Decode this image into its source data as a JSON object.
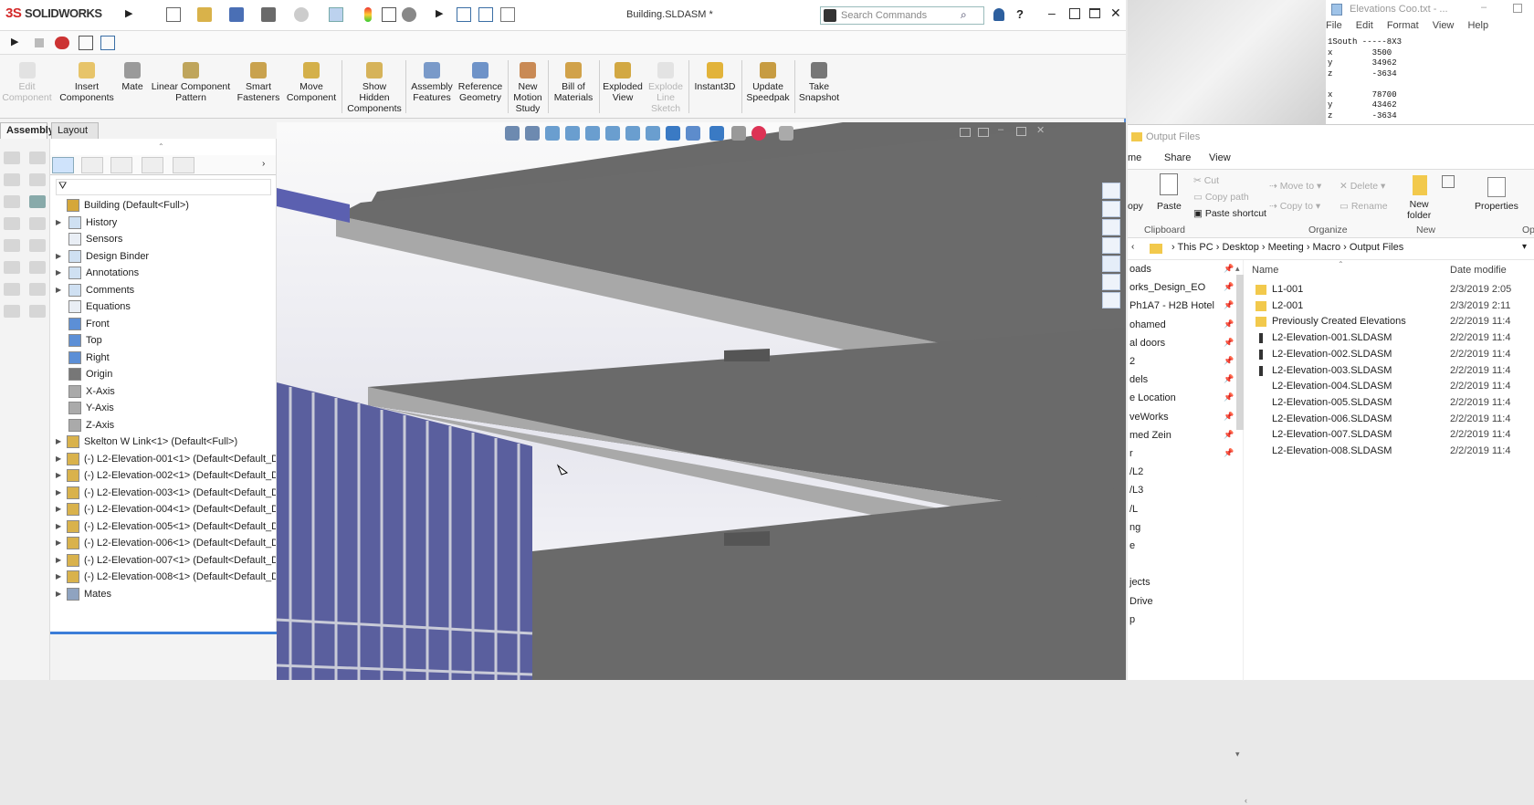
{
  "solidworks": {
    "logo_ds": "3S",
    "logo_text": "SOLIDWORKS",
    "document_title": "Building.SLDASM *",
    "search_placeholder": "Search Commands",
    "commands": [
      {
        "label": "Edit\nComponent",
        "disabled": true
      },
      {
        "label": "Insert\nComponents"
      },
      {
        "label": "Mate"
      },
      {
        "label": "Linear Component\nPattern"
      },
      {
        "label": "Smart\nFasteners"
      },
      {
        "label": "Move\nComponent"
      },
      {
        "label": "Show\nHidden\nComponents"
      },
      {
        "label": "Assembly\nFeatures"
      },
      {
        "label": "Reference\nGeometry"
      },
      {
        "label": "New\nMotion\nStudy"
      },
      {
        "label": "Bill of\nMaterials"
      },
      {
        "label": "Exploded\nView"
      },
      {
        "label": "Explode\nLine\nSketch",
        "disabled": true
      },
      {
        "label": "Instant3D"
      },
      {
        "label": "Update\nSpeedpak"
      },
      {
        "label": "Take\nSnapshot"
      }
    ],
    "tabs": [
      "Assembly",
      "Layout"
    ],
    "tree": [
      {
        "label": "Building  (Default<Full>)",
        "icon": "assembly-icon",
        "level": 0
      },
      {
        "label": "History",
        "icon": "folder-icon",
        "level": 1,
        "arrow": true
      },
      {
        "label": "Sensors",
        "icon": "sensor-icon",
        "level": 1
      },
      {
        "label": "Design Binder",
        "icon": "folder-icon",
        "level": 1,
        "arrow": true
      },
      {
        "label": "Annotations",
        "icon": "annotation-icon",
        "level": 1,
        "arrow": true
      },
      {
        "label": "Comments",
        "icon": "folder-icon",
        "level": 1,
        "arrow": true
      },
      {
        "label": "Equations",
        "icon": "equation-icon",
        "level": 1
      },
      {
        "label": "Front",
        "icon": "plane-icon",
        "level": 1
      },
      {
        "label": "Top",
        "icon": "plane-icon",
        "level": 1
      },
      {
        "label": "Right",
        "icon": "plane-icon",
        "level": 1
      },
      {
        "label": "Origin",
        "icon": "origin-icon",
        "level": 1
      },
      {
        "label": "X-Axis",
        "icon": "axis-icon",
        "level": 1
      },
      {
        "label": "Y-Axis",
        "icon": "axis-icon",
        "level": 1
      },
      {
        "label": "Z-Axis",
        "icon": "axis-icon",
        "level": 1
      },
      {
        "label": "Skelton W Link<1> (Default<Full>)",
        "icon": "part-icon",
        "level": 0,
        "arrow": true
      },
      {
        "label": "(-) L2-Elevation-001<1> (Default<Default_D",
        "icon": "part-icon",
        "level": 0,
        "arrow": true
      },
      {
        "label": "(-) L2-Elevation-002<1> (Default<Default_D",
        "icon": "part-icon",
        "level": 0,
        "arrow": true
      },
      {
        "label": "(-) L2-Elevation-003<1> (Default<Default_D",
        "icon": "part-icon",
        "level": 0,
        "arrow": true
      },
      {
        "label": "(-) L2-Elevation-004<1> (Default<Default_D",
        "icon": "part-icon",
        "level": 0,
        "arrow": true
      },
      {
        "label": "(-) L2-Elevation-005<1> (Default<Default_D",
        "icon": "part-icon",
        "level": 0,
        "arrow": true
      },
      {
        "label": "(-) L2-Elevation-006<1> (Default<Default_D",
        "icon": "part-icon",
        "level": 0,
        "arrow": true
      },
      {
        "label": "(-) L2-Elevation-007<1> (Default<Default_D",
        "icon": "part-icon",
        "level": 0,
        "arrow": true
      },
      {
        "label": "(-) L2-Elevation-008<1> (Default<Default_D",
        "icon": "part-icon",
        "level": 0,
        "arrow": true
      },
      {
        "label": "Mates",
        "icon": "mates-icon",
        "level": 0,
        "arrow": true
      }
    ]
  },
  "notepad": {
    "title": "Elevations Coo.txt - ...",
    "menu": [
      "File",
      "Edit",
      "Format",
      "View",
      "Help"
    ],
    "text": "1South -----8X3\nx        3500\ny        34962\nz        -3634\n\nx        78700\ny        43462\nz        -3634"
  },
  "explorer": {
    "title": "Output Files",
    "ribbon_tabs": [
      "me",
      "Share",
      "View"
    ],
    "ribbon": {
      "copy": "opy",
      "paste": "Paste",
      "cut": "Cut",
      "copy_path": "Copy path",
      "paste_shortcut": "Paste shortcut",
      "move_to": "Move to",
      "copy_to": "Copy to",
      "delete": "Delete",
      "rename": "Rename",
      "new_folder": "New\nfolder",
      "properties": "Properties",
      "open_partial": "Op",
      "group_clipboard": "Clipboard",
      "group_organize": "Organize",
      "group_new": "New"
    },
    "breadcrumb": [
      "This PC",
      "Desktop",
      "Meeting",
      "Macro",
      "Output Files"
    ],
    "columns": {
      "name": "Name",
      "date": "Date modifie"
    },
    "nav_items": [
      {
        "label": "oads",
        "pin": true
      },
      {
        "label": "orks_Design_EO",
        "pin": true
      },
      {
        "label": "Ph1A7 - H2B Hotel",
        "pin": true
      },
      {
        "label": "ohamed",
        "pin": true
      },
      {
        "label": "al doors",
        "pin": true
      },
      {
        "label": "2",
        "pin": true
      },
      {
        "label": "dels",
        "pin": true
      },
      {
        "label": "e Location",
        "pin": true
      },
      {
        "label": "veWorks",
        "pin": true
      },
      {
        "label": "med Zein",
        "pin": true
      },
      {
        "label": "r",
        "pin": true
      },
      {
        "label": "/L2"
      },
      {
        "label": "/L3"
      },
      {
        "label": "/L"
      },
      {
        "label": "ng"
      },
      {
        "label": "e"
      },
      {
        "label": ""
      },
      {
        "label": "jects"
      },
      {
        "label": "Drive"
      },
      {
        "label": "p"
      }
    ],
    "files": [
      {
        "name": "L1-001",
        "type": "folder",
        "date": "2/3/2019 2:05"
      },
      {
        "name": "L2-001",
        "type": "folder",
        "date": "2/3/2019 2:11"
      },
      {
        "name": "Previously Created Elevations",
        "type": "folder",
        "date": "2/2/2019 11:4"
      },
      {
        "name": "L2-Elevation-001.SLDASM",
        "type": "assembly",
        "date": "2/2/2019 11:4"
      },
      {
        "name": "L2-Elevation-002.SLDASM",
        "type": "assembly",
        "date": "2/2/2019 11:4"
      },
      {
        "name": "L2-Elevation-003.SLDASM",
        "type": "assembly",
        "date": "2/2/2019 11:4"
      },
      {
        "name": "L2-Elevation-004.SLDASM",
        "type": "file",
        "date": "2/2/2019 11:4"
      },
      {
        "name": "L2-Elevation-005.SLDASM",
        "type": "file",
        "date": "2/2/2019 11:4"
      },
      {
        "name": "L2-Elevation-006.SLDASM",
        "type": "file",
        "date": "2/2/2019 11:4"
      },
      {
        "name": "L2-Elevation-007.SLDASM",
        "type": "file",
        "date": "2/2/2019 11:4"
      },
      {
        "name": "L2-Elevation-008.SLDASM",
        "type": "file",
        "date": "2/2/2019 11:4"
      }
    ]
  },
  "colors": {
    "accent": "#3b7dd8",
    "slab_top": "#6a6a6a",
    "slab_edge": "#a8a8a8",
    "glass": "#5a5f9e",
    "folder": "#f2c94c"
  }
}
